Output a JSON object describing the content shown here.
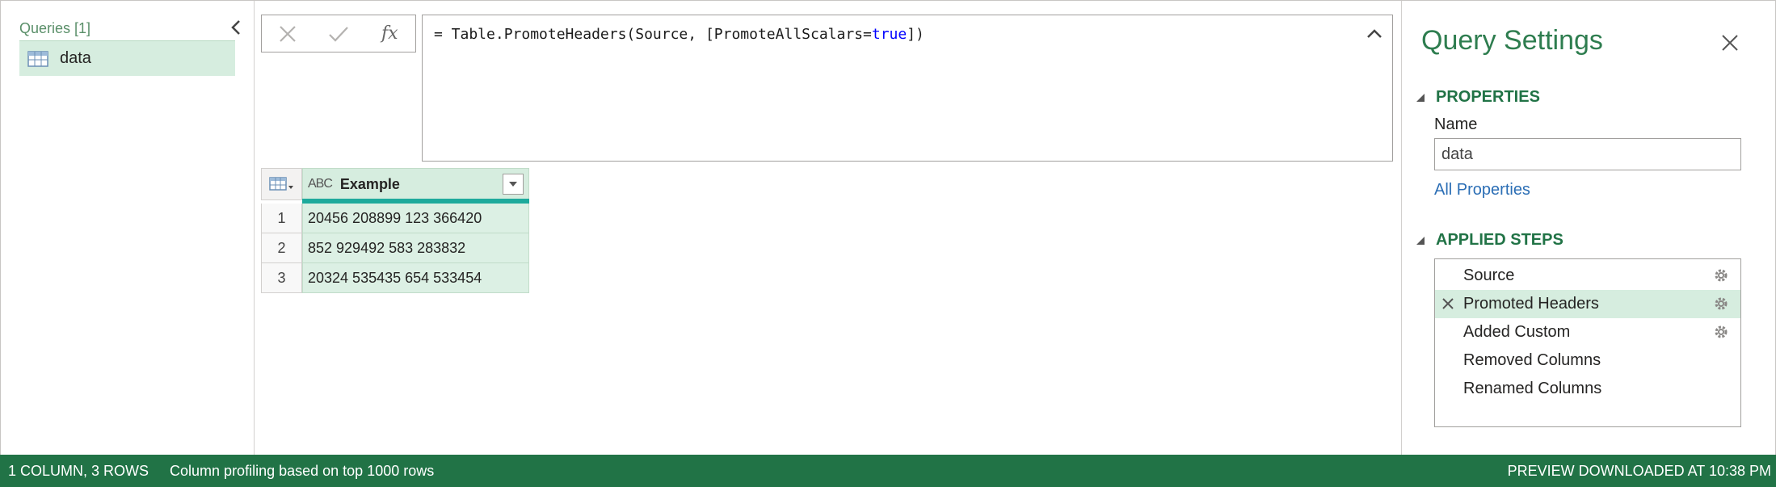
{
  "queries_pane": {
    "header": "Queries [1]",
    "items": [
      {
        "label": "data",
        "icon": "table-icon"
      }
    ]
  },
  "formula_bar": {
    "cancel_icon": "close-icon",
    "commit_icon": "checkmark-icon",
    "fx_label": "fx",
    "formula_prefix": "= Table.PromoteHeaders(Source, [PromoteAllScalars=",
    "formula_keyword": "true",
    "formula_suffix": "])"
  },
  "grid": {
    "column": {
      "type_label": "ABC",
      "name": "Example"
    },
    "rows": [
      {
        "num": "1",
        "value": "20456 208899 123 366420"
      },
      {
        "num": "2",
        "value": "852 929492 583 283832"
      },
      {
        "num": "3",
        "value": "20324 535435 654 533454"
      }
    ]
  },
  "settings": {
    "title": "Query Settings",
    "properties_header": "PROPERTIES",
    "name_label": "Name",
    "name_value": "data",
    "all_properties": "All Properties",
    "applied_steps_header": "APPLIED STEPS",
    "steps": [
      {
        "label": "Source",
        "has_gear": true,
        "selected": false
      },
      {
        "label": "Promoted Headers",
        "has_gear": true,
        "selected": true
      },
      {
        "label": "Added Custom",
        "has_gear": true,
        "selected": false
      },
      {
        "label": "Removed Columns",
        "has_gear": false,
        "selected": false
      },
      {
        "label": "Renamed Columns",
        "has_gear": false,
        "selected": false
      }
    ]
  },
  "status_bar": {
    "counts": "1 COLUMN, 3 ROWS",
    "profiling": "Column profiling based on top 1000 rows",
    "preview": "PREVIEW DOWNLOADED AT 10:38 PM"
  },
  "colors": {
    "accent_green": "#217346",
    "selected_bg": "#d6eddf",
    "quality_bar": "#1eaa9c",
    "link_blue": "#2b6eb5"
  }
}
